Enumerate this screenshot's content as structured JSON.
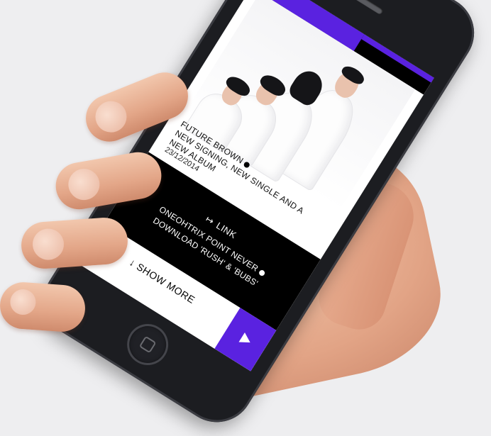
{
  "article": {
    "title_line1": "FUTURE BROWN",
    "title_line2": "NEW SIGNING, NEW SINGLE AND A",
    "title_line3": "NEW ALBUM",
    "date": "23/12/2014"
  },
  "link_card": {
    "link_label": "LINK",
    "arrow": "↦",
    "line1": "ONEOHTRIX POINT NEVER",
    "line2": "DOWNLOAD 'RUSH' & 'BUBS'"
  },
  "show_more": {
    "arrow": "↓",
    "label": "SHOW MORE"
  },
  "colors": {
    "accent": "#5a22e0",
    "panel": "#000000",
    "background": "#eeeef0"
  },
  "icons": [
    "play-icon",
    "arrow-down-icon",
    "link-arrow-icon",
    "home-button-icon"
  ]
}
